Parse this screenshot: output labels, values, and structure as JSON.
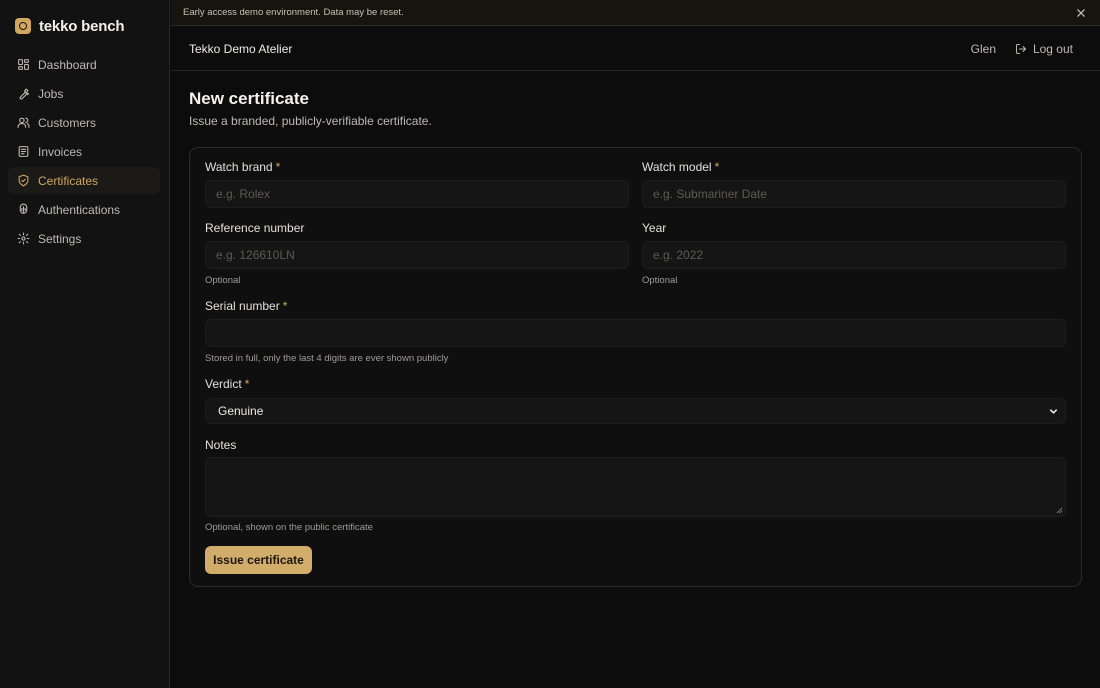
{
  "brand": {
    "name": "tekko bench"
  },
  "sidebar": {
    "items": [
      {
        "label": "Dashboard",
        "icon": "dashboard-icon"
      },
      {
        "label": "Jobs",
        "icon": "wrench-icon"
      },
      {
        "label": "Customers",
        "icon": "users-icon"
      },
      {
        "label": "Invoices",
        "icon": "receipt-icon"
      },
      {
        "label": "Certificates",
        "icon": "shield-icon",
        "active": true
      },
      {
        "label": "Authentications",
        "icon": "fingerprint-icon"
      },
      {
        "label": "Settings",
        "icon": "gear-icon"
      }
    ]
  },
  "banner": {
    "text": "Early access demo environment. Data may be reset."
  },
  "topbar": {
    "org": "Tekko Demo Atelier",
    "user": "Glen",
    "logout": "Log out"
  },
  "page": {
    "title": "New certificate",
    "subtitle": "Issue a branded, publicly-verifiable certificate."
  },
  "form": {
    "watch_brand": {
      "label": "Watch brand",
      "required": "*",
      "placeholder": "e.g. Rolex",
      "value": ""
    },
    "watch_model": {
      "label": "Watch model",
      "required": "*",
      "placeholder": "e.g. Submariner Date",
      "value": ""
    },
    "reference_number": {
      "label": "Reference number",
      "placeholder": "e.g. 126610LN",
      "hint": "Optional",
      "value": ""
    },
    "year": {
      "label": "Year",
      "placeholder": "e.g. 2022",
      "hint": "Optional",
      "value": ""
    },
    "serial_number": {
      "label": "Serial number",
      "required": "*",
      "value": "",
      "hint": "Stored in full, only the last 4 digits are ever shown publicly"
    },
    "verdict": {
      "label": "Verdict",
      "required": "*",
      "selected": "Genuine"
    },
    "notes": {
      "label": "Notes",
      "value": "",
      "hint": "Optional, shown on the public certificate"
    },
    "submit_label": "Issue certificate"
  },
  "colors": {
    "accent": "#cfa760",
    "background": "#0c0c0c",
    "button": "#d1ac6a"
  }
}
